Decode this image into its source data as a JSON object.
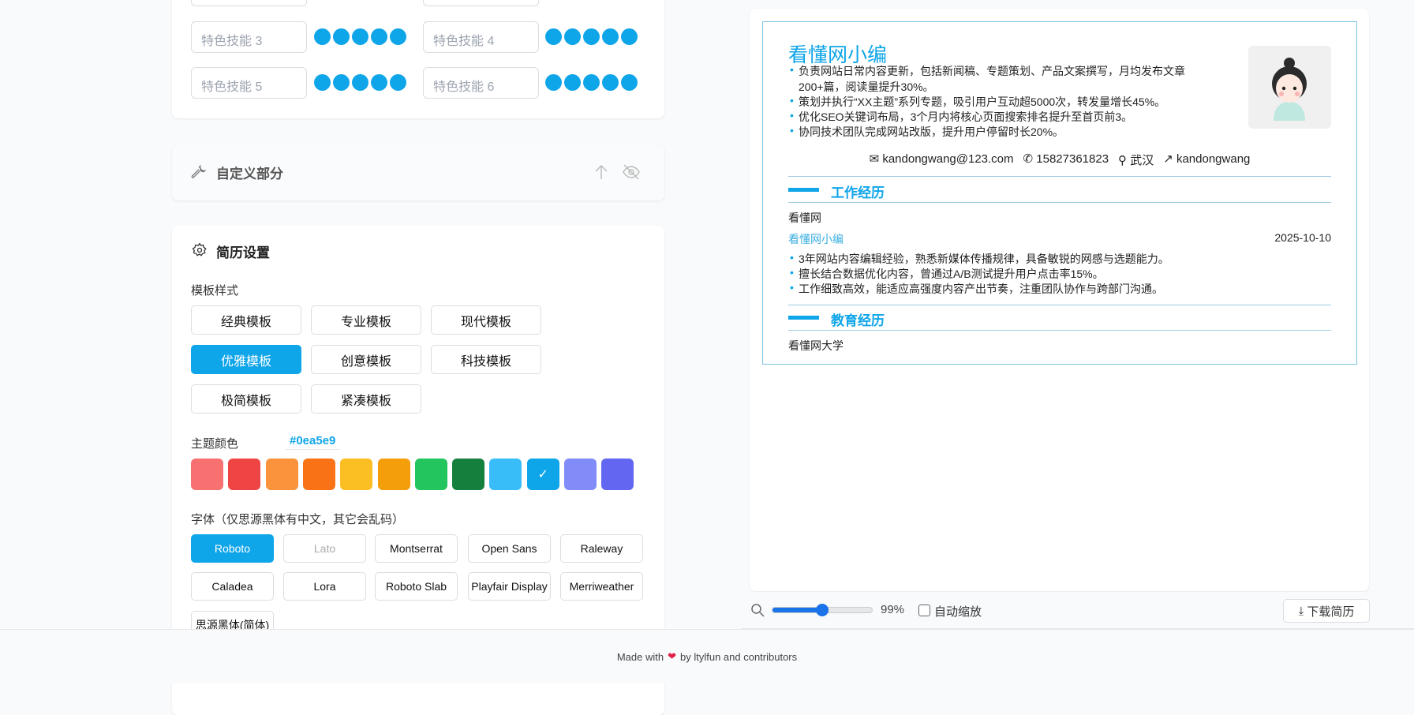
{
  "skills": {
    "items": [
      {
        "placeholder": "特色技能 3",
        "level": 5
      },
      {
        "placeholder": "特色技能 4",
        "level": 5
      },
      {
        "placeholder": "特色技能 5",
        "level": 5
      },
      {
        "placeholder": "特色技能 6",
        "level": 5
      }
    ]
  },
  "custom_section": {
    "title": "自定义部分"
  },
  "settings": {
    "title": "简历设置",
    "template_label": "模板样式",
    "templates": [
      "经典模板",
      "专业模板",
      "现代模板",
      "优雅模板",
      "创意模板",
      "科技模板",
      "极简模板",
      "紧凑模板"
    ],
    "active_template": "优雅模板",
    "theme_label": "主题颜色",
    "theme_value": "#0ea5e9",
    "colors": [
      "#f87171",
      "#ef4444",
      "#fb923c",
      "#f97316",
      "#fbbf24",
      "#f59e0b",
      "#22c55e",
      "#15803d",
      "#38bdf8",
      "#0ea5e9",
      "#818cf8",
      "#6366f1"
    ],
    "font_label": "字体（仅思源黑体有中文，其它会乱码）",
    "fonts": [
      "Roboto",
      "Lato",
      "Montserrat",
      "Open Sans",
      "Raleway",
      "Caladea",
      "Lora",
      "Roboto Slab",
      "Playfair Display",
      "Merriweather",
      "思源黑体(简体)"
    ],
    "active_font": "Roboto"
  },
  "resume": {
    "name": "看懂网小编",
    "summary": [
      "负责网站日常内容更新，包括新闻稿、专题策划、产品文案撰写，月均发布文章",
      "200+篇，阅读量提升30%。",
      "策划并执行“XX主题”系列专题，吸引用户互动超5000次，转发量增长45%。",
      "优化SEO关键词布局，3个月内将核心页面搜索排名提升至首页前3。",
      "协同技术团队完成网站改版，提升用户停留时长20%。"
    ],
    "contact": {
      "email": "kandongwang@123.com",
      "phone": "15827361823",
      "location": "武汉",
      "link": "kandongwang"
    },
    "work_title": "工作经历",
    "work": {
      "company": "看懂网",
      "position": "看懂网小编",
      "date": "2025-10-10",
      "bullets": [
        "3年网站内容编辑经验，熟悉新媒体传播规律，具备敏锐的网感与选题能力。",
        "擅长结合数据优化内容，曾通过A/B测试提升用户点击率15%。",
        "工作细致高效，能适应高强度内容产出节奏，注重团队协作与跨部门沟通。"
      ]
    },
    "edu_title": "教育经历",
    "edu": {
      "school": "看懂网大学"
    }
  },
  "toolbar": {
    "zoom": "99%",
    "zoom_value": 99,
    "auto_zoom_label": "自动缩放",
    "auto_zoom": false,
    "download_label": "下载简历"
  },
  "footer": {
    "prefix": "Made with",
    "suffix": "by ltylfun and contributors"
  }
}
